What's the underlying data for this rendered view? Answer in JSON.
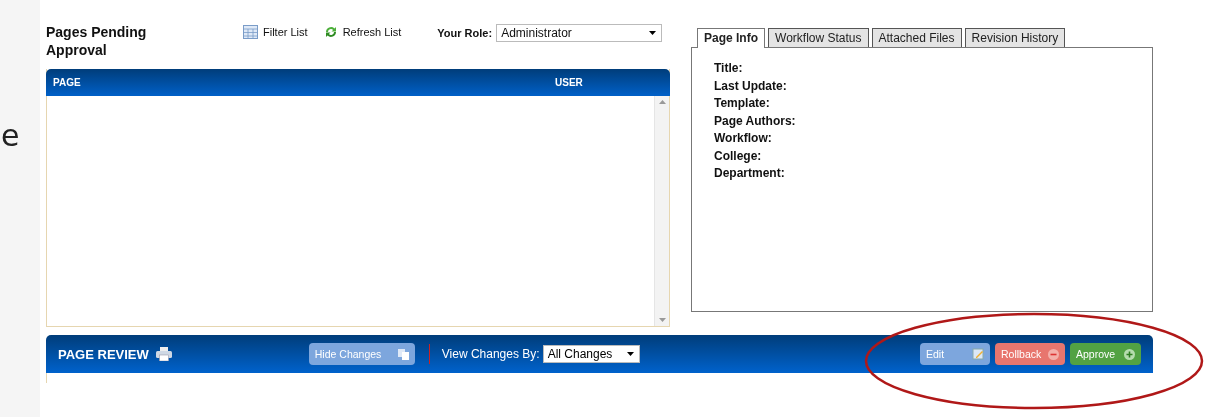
{
  "slide_fragment": "e",
  "pending": {
    "title": "Pages Pending Approval",
    "filter": "Filter List",
    "refresh": "Refresh List",
    "role_label": "Your Role:",
    "role": "Administrator",
    "columns": [
      "PAGE",
      "USER"
    ]
  },
  "info": {
    "tabs": [
      {
        "label": "Page Info",
        "selected": true
      },
      {
        "label": "Workflow Status",
        "selected": false
      },
      {
        "label": "Attached Files",
        "selected": false
      },
      {
        "label": "Revision History",
        "selected": false
      }
    ],
    "fields": [
      "Title:",
      "Last Update:",
      "Template:",
      "Page Authors:",
      "Workflow:",
      "College:",
      "Department:"
    ]
  },
  "review": {
    "title": "PAGE REVIEW",
    "hide": "Hide Changes",
    "view_label": "View Changes By:",
    "view": "All Changes",
    "actions": [
      {
        "label": "Edit",
        "kind": "edit"
      },
      {
        "label": "Rollback",
        "kind": "rollback"
      },
      {
        "label": "Approve",
        "kind": "approve"
      }
    ]
  }
}
